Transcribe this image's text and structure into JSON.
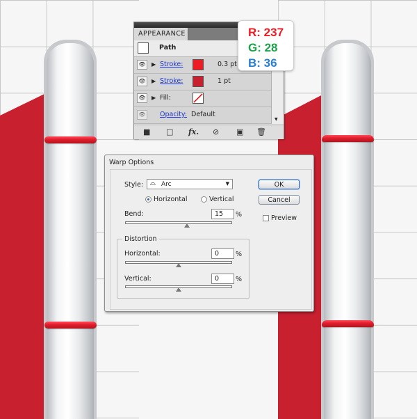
{
  "appearance_panel": {
    "tab_title": "APPEARANCE",
    "rows": [
      {
        "label": "Path",
        "value": ""
      },
      {
        "label": "Stroke:",
        "value": "0.3 pt",
        "swatch_color": "#ed1c24"
      },
      {
        "label": "Stroke:",
        "value": "1 pt",
        "swatch_color": "#c8202f"
      },
      {
        "label": "Fill:",
        "value": ""
      },
      {
        "label": "Opacity:",
        "value": "Default"
      }
    ],
    "footer_icons": [
      "new-stroke-icon",
      "new-fill-icon",
      "fx-icon",
      "clear-icon",
      "duplicate-icon",
      "delete-icon"
    ],
    "fx_label": "fx."
  },
  "rgb_tooltip": {
    "r": "R: 237",
    "g": "G: 28",
    "b": "B: 36",
    "r_color": "#ed1c24",
    "g_color": "#1ca34a",
    "b_color": "#2a7fd1"
  },
  "warp_dialog": {
    "title": "Warp Options",
    "style_label": "Style:",
    "style_value": "Arc",
    "orientation": {
      "horizontal": "Horizontal",
      "vertical": "Vertical",
      "selected": "horizontal"
    },
    "bend_label": "Bend:",
    "bend_value": "15",
    "bend_percent": 15,
    "distortion_label": "Distortion",
    "horizontal_label": "Horizontal:",
    "horizontal_value": "0",
    "vertical_label": "Vertical:",
    "vertical_value": "0",
    "percent": "%",
    "ok_label": "OK",
    "cancel_label": "Cancel",
    "preview_label": "Preview",
    "preview_checked": false
  },
  "colors": {
    "brand_red": "#c8202f",
    "band_red": "#e51f2f"
  }
}
